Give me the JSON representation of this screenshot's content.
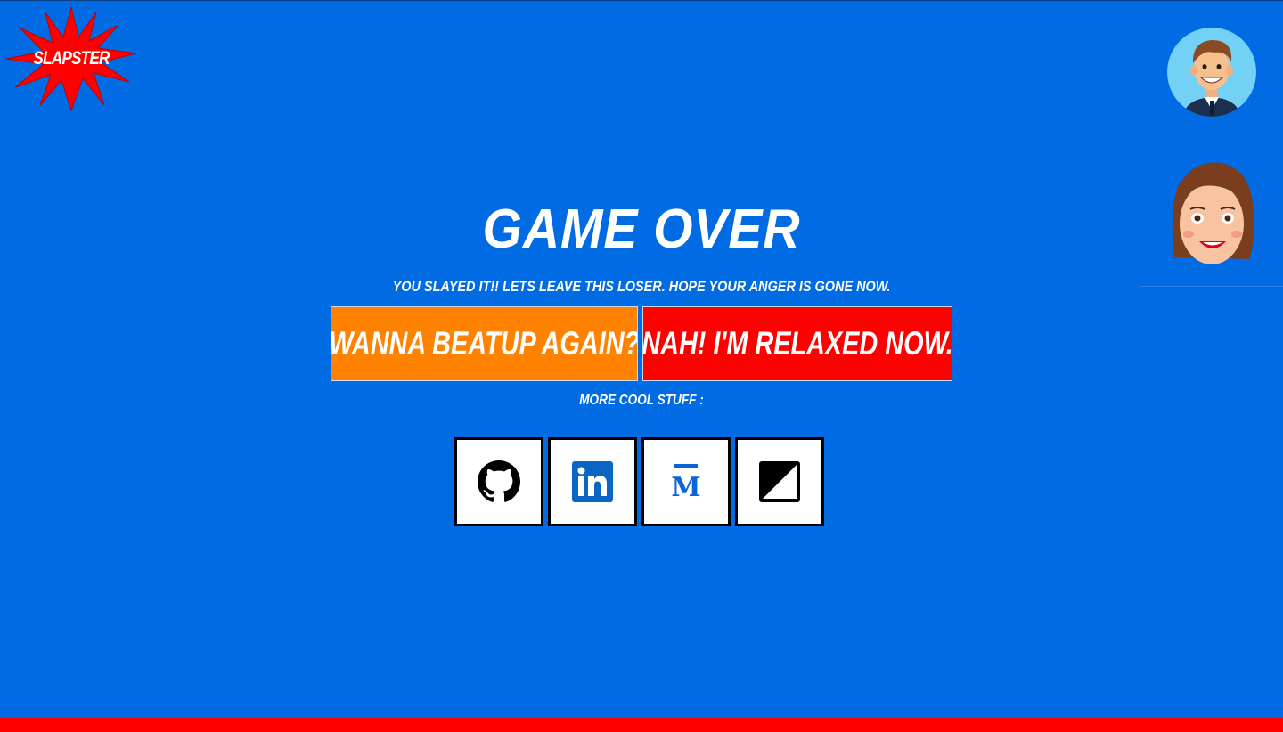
{
  "logo": {
    "text": "SLAPSTER",
    "icon": "starburst-logo",
    "color": "#ff0000"
  },
  "players": [
    {
      "name": "man-avatar-icon"
    },
    {
      "name": "woman-avatar-icon"
    }
  ],
  "game_over": {
    "title": "GAME OVER",
    "subtitle": "YOU SLAYED IT!! LETS LEAVE THIS LOSER. HOPE YOUR ANGER IS GONE NOW.",
    "again_label": "WANNA BEATUP AGAIN?",
    "relax_label": "NAH! I'M RELAXED NOW.",
    "more_label": "MORE COOL STUFF :"
  },
  "social": [
    {
      "icon": "github-icon"
    },
    {
      "icon": "linkedin-icon"
    },
    {
      "icon": "medium-icon"
    },
    {
      "icon": "contrast-icon"
    }
  ],
  "colors": {
    "background": "#006be3",
    "again_button": "#ff8200",
    "relax_button": "#ff0000",
    "bottom_bar": "#ff0000"
  }
}
